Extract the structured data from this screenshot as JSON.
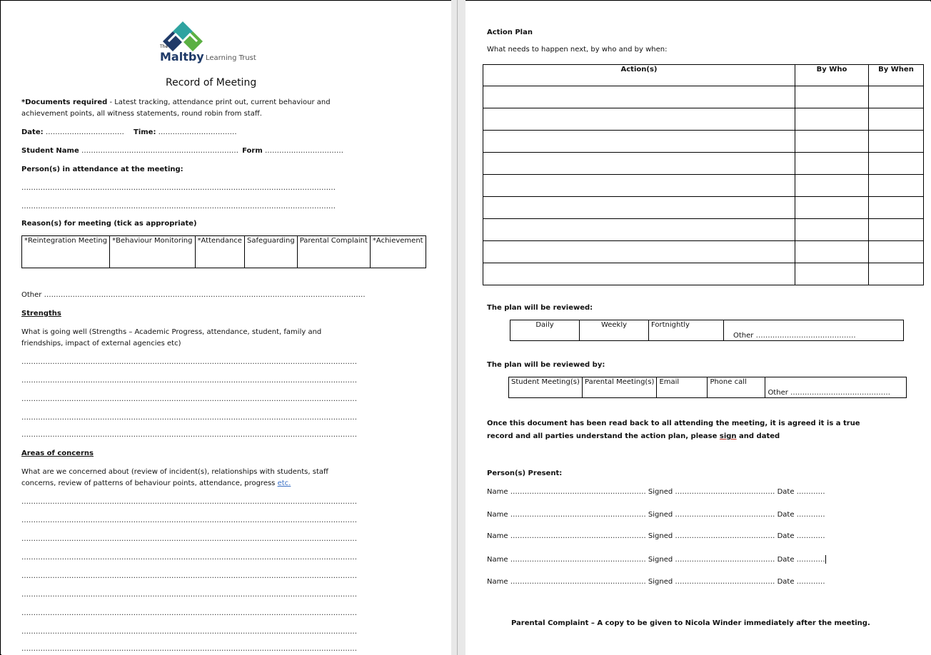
{
  "left": {
    "logo": {
      "the": "The",
      "brand": "Maltby",
      "sub": "Learning Trust"
    },
    "title": "Record of Meeting",
    "docs_required_bold": "*Documents required",
    "docs_required_rest": " - Latest tracking, attendance print out, current behaviour and",
    "docs_required_line2": "achievement points, all witness statements, round robin from staff.",
    "date_label": "Date:",
    "date_dots": "……………………………",
    "time_label": "Time:",
    "time_dots": "……………………………",
    "student_label": "Student Name",
    "student_dots": "…………………………………………………………",
    "form_label": "Form",
    "form_dots": "……………………………",
    "attendance_heading": "Person(s) in attendance at the meeting:",
    "attendance_dots": "……………………………………………………………………………………………………………………",
    "reasons_heading": "Reason(s) for meeting (tick as appropriate)",
    "reasons": [
      "*Reintegration Meeting",
      "*Behaviour Monitoring",
      "*Attendance",
      "Safeguarding",
      "Parental Complaint",
      "*Achievement"
    ],
    "other_label": "Other",
    "other_dots": "………………………………………………………………………………………………………………………",
    "strengths_heading": "Strengths",
    "strengths_q1": "What is going well (Strengths – Academic Progress, attendance, student, family and",
    "strengths_q2": "friendships, impact of external agencies etc)",
    "line_dots": "……………………………………………………………………………………………………………………………",
    "concerns_heading": "Areas of concerns",
    "concerns_q1": "What are we concerned about (review of incident(s), relationships with students, staff",
    "concerns_q2a": "concerns, review of patterns of behaviour points, attendance, progress ",
    "concerns_q2b": "etc."
  },
  "right": {
    "action_plan_heading": "Action Plan",
    "action_plan_sub": "What needs to happen next, by who and by when:",
    "action_headers": [
      "Action(s)",
      "By Who",
      "By When"
    ],
    "reviewed_heading": "The plan will be reviewed:",
    "review_opts": [
      "Daily",
      "Weekly",
      "Fortnightly"
    ],
    "other_label": "Other",
    "other_dots": "……………………………………",
    "reviewed_by_heading": "The plan will be reviewed by:",
    "reviewed_by_opts": [
      "Student Meeting(s)",
      "Parental Meeting(s)",
      "Email",
      "Phone call"
    ],
    "reviewed_by_other_dots": "……………………………………",
    "agreement_1": "Once this document has been read back to all attending the meeting, it is agreed it is a true",
    "agreement_2a": "record and all parties understand the action plan, please ",
    "agreement_2b": "sign",
    "agreement_2c": " and dated",
    "present_heading": "Person(s) Present:",
    "sign_rows": [
      {
        "name": "Name",
        "name_dots": "…………………………………………………",
        "signed": "Signed",
        "signed_dots": "……………………………………",
        "date": "Date",
        "date_dots": "…………"
      },
      {
        "name": "Name",
        "name_dots": "…………………………………………………",
        "signed": "Signed",
        "signed_dots": "……………………………………",
        "date": "Date",
        "date_dots": "…………"
      },
      {
        "name": "Name",
        "name_dots": "…………………………………………………",
        "signed": "Signed",
        "signed_dots": "……………………………………",
        "date": "Date",
        "date_dots": "…………"
      },
      {
        "name": "Name",
        "name_dots": "…………………………………………………",
        "signed": "Signed",
        "signed_dots": "……………………………………",
        "date": "Date",
        "date_dots": "…………"
      },
      {
        "name": "Name",
        "name_dots": "…………………………………………………",
        "signed": "Signed",
        "signed_dots": "……………………………………",
        "date": "Date",
        "date_dots": "…………"
      }
    ],
    "footer": "Parental Complaint – A copy to be given to Nicola Winder immediately after the meeting."
  },
  "colors": {
    "logo_teal": "#2ea3a0",
    "logo_navy": "#1f3a68",
    "logo_green": "#5bb043",
    "link_blue": "#3a6fc4"
  }
}
